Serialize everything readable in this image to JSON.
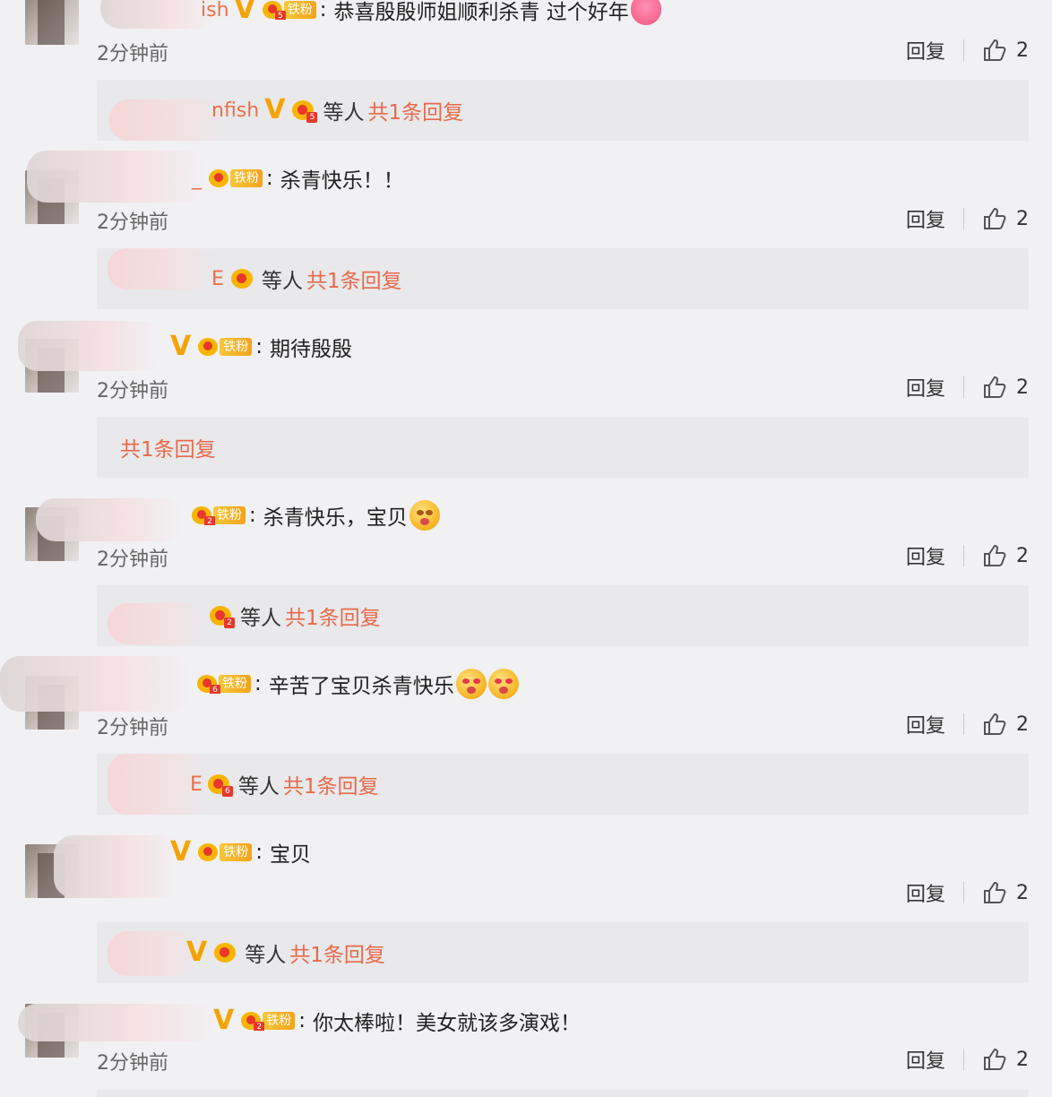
{
  "comments": [
    {
      "username_tail": "ish",
      "verified": true,
      "fan_level": "5",
      "fan_tag": "铁粉",
      "text": "恭喜殷殷师姐顺利杀青 过个好年",
      "emoji": "heart-emoji",
      "time": "2分钟前",
      "reply_label": "回复",
      "likes": "2",
      "sub": {
        "username_tail": "nfish",
        "verified": true,
        "fan_level": "5",
        "people": "等人",
        "count": "共1条回复"
      }
    },
    {
      "username_tail": "_",
      "verified": false,
      "fan_level": "",
      "fan_tag": "铁粉",
      "text": "杀青快乐！！",
      "emoji": "",
      "time": "2分钟前",
      "reply_label": "回复",
      "likes": "2",
      "sub": {
        "username_tail": "E",
        "verified": false,
        "fan_level": "",
        "people": "等人",
        "count": "共1条回复"
      }
    },
    {
      "username_tail": "",
      "verified": true,
      "fan_level": "",
      "fan_tag": "铁粉",
      "text": "期待殷殷",
      "emoji": "",
      "time": "2分钟前",
      "reply_label": "回复",
      "likes": "2",
      "sub": {
        "username_tail": "",
        "verified": false,
        "fan_level": "",
        "people": "",
        "count": "共1条回复"
      }
    },
    {
      "username_tail": "",
      "verified": false,
      "fan_level": "2",
      "fan_tag": "铁粉",
      "text": "杀青快乐，宝贝",
      "emoji": "kiss-emoji",
      "time": "2分钟前",
      "reply_label": "回复",
      "likes": "2",
      "sub": {
        "username_tail": "",
        "verified": false,
        "fan_level": "2",
        "people": "等人",
        "count": "共1条回复"
      }
    },
    {
      "username_tail": "",
      "verified": false,
      "fan_level": "6",
      "fan_tag": "铁粉",
      "text": "辛苦了宝贝杀青快乐",
      "emoji": "heart-eyes-emoji",
      "time": "2分钟前",
      "reply_label": "回复",
      "likes": "2",
      "sub": {
        "username_tail": "E",
        "verified": false,
        "fan_level": "6",
        "people": "等人",
        "count": "共1条回复"
      }
    },
    {
      "username_tail": "",
      "verified": true,
      "fan_level": "",
      "fan_tag": "铁粉",
      "text": "宝贝",
      "emoji": "",
      "time": "",
      "reply_label": "回复",
      "likes": "2",
      "sub": {
        "username_tail": "",
        "verified": true,
        "fan_level": "",
        "people": "等人",
        "count": "共1条回复"
      }
    },
    {
      "username_tail": "",
      "verified": true,
      "fan_level": "2",
      "fan_tag": "铁粉",
      "text": "你太棒啦！美女就该多演戏！",
      "emoji": "",
      "time": "2分钟前",
      "reply_label": "回复",
      "likes": "2",
      "sub": null
    }
  ],
  "colors": {
    "background": "#f1f0f3",
    "subreply_bg": "#e9e8eb",
    "link": "#e86a4a",
    "verified": "#f5a300",
    "fan_badge": "#f4a41a"
  }
}
